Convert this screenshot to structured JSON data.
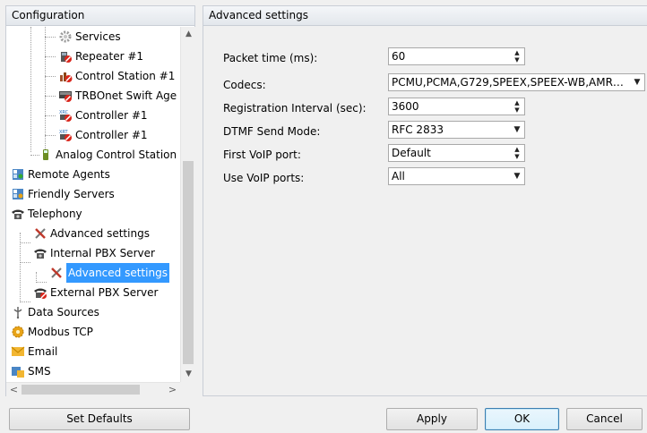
{
  "left_panel": {
    "header": "Configuration",
    "tree": [
      {
        "label": "Services",
        "icon": "gear-icon"
      },
      {
        "label": "Repeater #1",
        "icon": "repeater-icon"
      },
      {
        "label": "Control Station #1",
        "icon": "control-station-icon"
      },
      {
        "label": "TRBOnet Swift Age",
        "icon": "swift-agent-icon"
      },
      {
        "label": "Controller #1",
        "icon": "xrc-controller-icon"
      },
      {
        "label": "Controller #1",
        "icon": "xrt-controller-icon"
      },
      {
        "label": "Analog Control Station",
        "icon": "analog-station-icon"
      },
      {
        "label": "Remote Agents",
        "icon": "remote-agents-icon"
      },
      {
        "label": "Friendly Servers",
        "icon": "friendly-servers-icon"
      },
      {
        "label": "Telephony",
        "icon": "telephone-icon"
      },
      {
        "label": "Advanced settings",
        "icon": "tools-icon"
      },
      {
        "label": "Internal PBX Server",
        "icon": "telephone-icon"
      },
      {
        "label": "Advanced settings",
        "icon": "tools-icon",
        "selected": true
      },
      {
        "label": "External PBX Server",
        "icon": "external-pbx-icon"
      },
      {
        "label": "Data Sources",
        "icon": "data-sources-icon"
      },
      {
        "label": "Modbus TCP",
        "icon": "modbus-icon"
      },
      {
        "label": "Email",
        "icon": "email-icon"
      },
      {
        "label": "SMS",
        "icon": "sms-icon"
      }
    ]
  },
  "right_panel": {
    "header": "Advanced settings",
    "fields": [
      {
        "label": "Packet time (ms):",
        "value": "60",
        "control": "spin"
      },
      {
        "label": "Codecs:",
        "value": "PCMU,PCMA,G729,SPEEX,SPEEX-WB,AMR…",
        "control": "dropdown"
      },
      {
        "label": "Registration Interval (sec):",
        "value": "3600",
        "control": "spin"
      },
      {
        "label": "DTMF Send Mode:",
        "value": "RFC 2833",
        "control": "dropdown"
      },
      {
        "label": "First VoIP port:",
        "value": "Default",
        "control": "spin"
      },
      {
        "label": "Use VoIP ports:",
        "value": "All",
        "control": "dropdown"
      }
    ]
  },
  "buttons": {
    "set_defaults": "Set Defaults",
    "apply": "Apply",
    "ok": "OK",
    "cancel": "Cancel"
  },
  "colors": {
    "selection": "#3399ff",
    "panel_border": "#c9ced6",
    "background": "#f0f0f0"
  }
}
